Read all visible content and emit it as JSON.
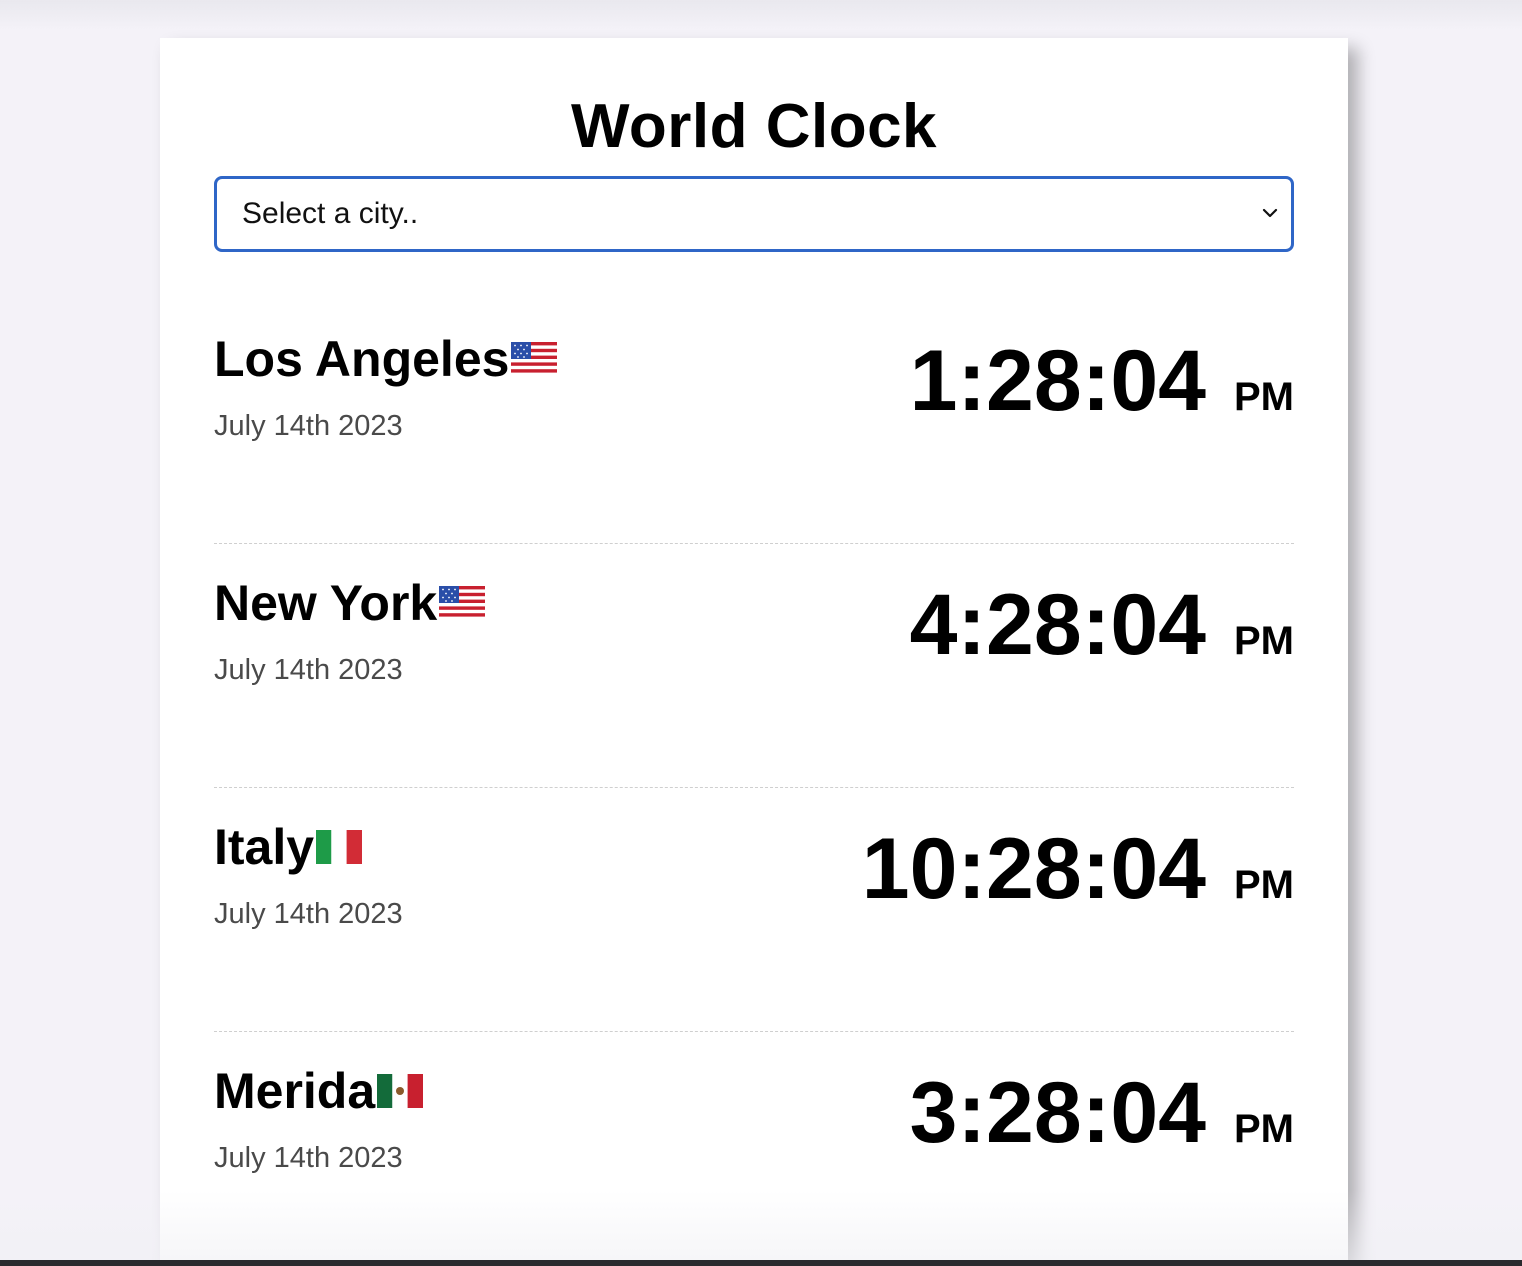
{
  "app": {
    "title": "World Clock"
  },
  "select": {
    "placeholder": "Select a city.."
  },
  "cities": [
    {
      "name": "Los Angeles",
      "flag": "us-flag",
      "date": "July 14th 2023",
      "time": "1:28:04",
      "ampm": "PM"
    },
    {
      "name": "New York",
      "flag": "us-flag",
      "date": "July 14th 2023",
      "time": "4:28:04",
      "ampm": "PM"
    },
    {
      "name": "Italy",
      "flag": "italy-flag",
      "date": "July 14th 2023",
      "time": "10:28:04",
      "ampm": "PM"
    },
    {
      "name": "Merida",
      "flag": "mexico-flag",
      "date": "July 14th 2023",
      "time": "3:28:04",
      "ampm": "PM"
    }
  ],
  "colors": {
    "select_border": "#2f66c7",
    "date_text": "#4a4a4a",
    "divider": "#cfcfcf"
  }
}
